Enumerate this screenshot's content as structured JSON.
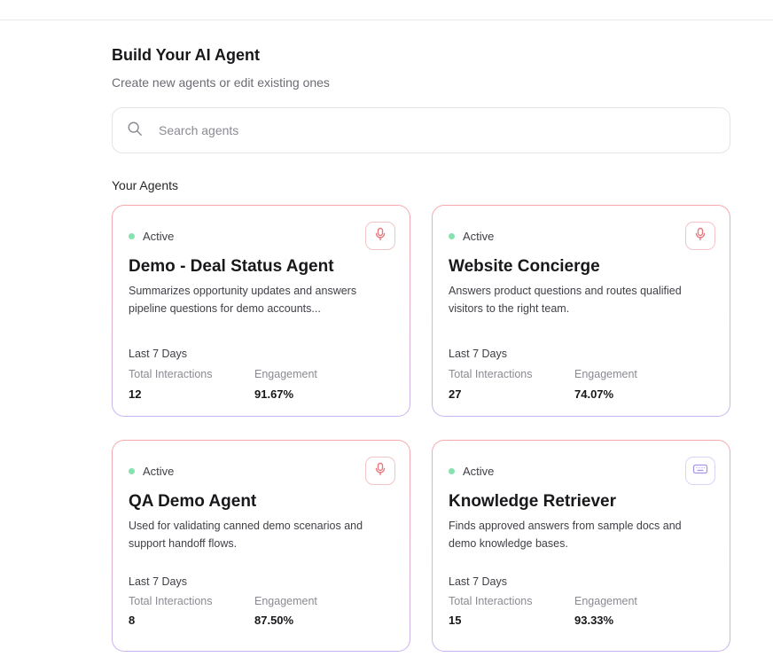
{
  "header": {
    "title": "Build Your AI Agent",
    "subtitle": "Create new agents or edit existing ones"
  },
  "search": {
    "placeholder": "Search agents",
    "icon": "search-icon"
  },
  "section_title": "Your Agents",
  "colors": {
    "active_dot": "#86e3b0",
    "card_border_top": "#f7a9ad",
    "card_border_bottom": "#c9b4f3",
    "mic_icon": "#e8797e",
    "chat_icon": "#a996e6"
  },
  "agents": [
    {
      "status": "Active",
      "type_icon": "microphone-icon",
      "name": "Demo - Deal Status Agent",
      "description": "Summarizes opportunity updates and answers pipeline questions for demo accounts...",
      "period": "Last 7 Days",
      "interactions_label": "Total Interactions",
      "interactions": "12",
      "engagement_label": "Engagement",
      "engagement": "91.67%"
    },
    {
      "status": "Active",
      "type_icon": "microphone-icon",
      "name": "Website Concierge",
      "description": "Answers product questions and routes qualified visitors to the right team.",
      "period": "Last 7 Days",
      "interactions_label": "Total Interactions",
      "interactions": "27",
      "engagement_label": "Engagement",
      "engagement": "74.07%"
    },
    {
      "status": "Active",
      "type_icon": "microphone-icon",
      "name": "QA Demo Agent",
      "description": "Used for validating canned demo scenarios and support handoff flows.",
      "period": "Last 7 Days",
      "interactions_label": "Total Interactions",
      "interactions": "8",
      "engagement_label": "Engagement",
      "engagement": "87.50%"
    },
    {
      "status": "Active",
      "type_icon": "keyboard-icon",
      "name": "Knowledge Retriever",
      "description": "Finds approved answers from sample docs and demo knowledge bases.",
      "period": "Last 7 Days",
      "interactions_label": "Total Interactions",
      "interactions": "15",
      "engagement_label": "Engagement",
      "engagement": "93.33%"
    }
  ]
}
